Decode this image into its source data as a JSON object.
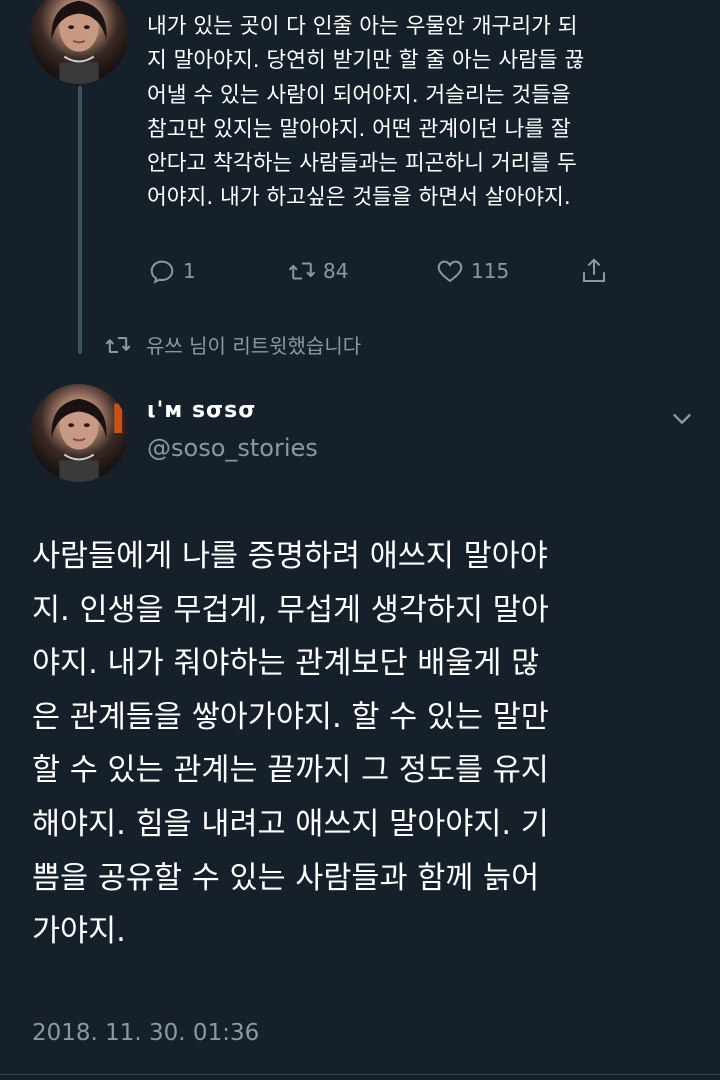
{
  "top_tweet": {
    "lines": [
      "내가 있는 곳이 다 인줄 아는 우물안 개구리가 되",
      "지 말아야지. 당연히 받기만 할 줄 아는 사람들 끊",
      "어낼 수 있는 사람이 되어야지. 거슬리는 것들을",
      "참고만 있지는 말아야지. 어떤 관계이던 나를 잘",
      "안다고 착각하는 사람들과는 피곤하니 거리를 두",
      "어야지. 내가 하고싶은 것들을 하면서 살아야지."
    ],
    "actions": {
      "reply_count": "1",
      "retweet_count": "84",
      "like_count": "115"
    }
  },
  "retweet_notice": "유쓰 님이 리트윗했습니다",
  "main_tweet": {
    "display_name": "ι'м ѕσѕσ",
    "handle": "@soso_stories",
    "lines": [
      "사람들에게 나를 증명하려 애쓰지 말아야",
      "지. 인생을 무겁게, 무섭게 생각하지 말아",
      "야지. 내가 줘야하는 관계보단 배울게 많",
      "은 관계들을 쌓아가야지. 할 수 있는 말만",
      "할 수 있는 관계는 끝까지 그 정도를 유지",
      "해야지. 힘을 내려고 애쓰지 말아야지. 기",
      "쁨을 공유할 수 있는 사람들과 함께 늙어",
      "가야지."
    ],
    "timestamp": "2018. 11. 30. 01:36"
  },
  "icons": {
    "reply": "reply-icon",
    "retweet": "retweet-icon",
    "like": "heart-icon",
    "share": "share-icon",
    "more": "chevron-down-icon"
  },
  "colors": {
    "background": "#15202b",
    "text": "#ffffff",
    "secondary": "#8899a6",
    "thread_line": "#3d5466"
  }
}
